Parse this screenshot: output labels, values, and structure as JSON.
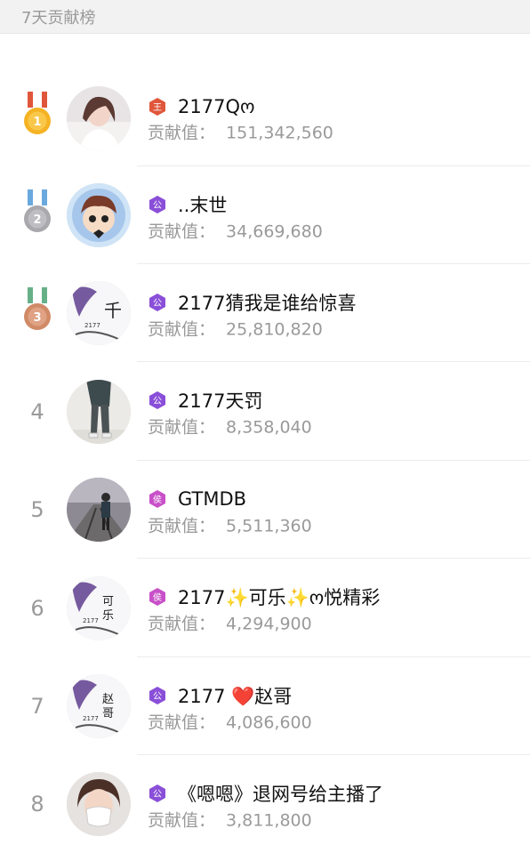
{
  "header": {
    "title": "7天贡献榜"
  },
  "contrib_label": "贡献值：",
  "rows": [
    {
      "rank": "1",
      "medal": "gold-medal-icon",
      "badge": {
        "char": "王",
        "color": "#e0563b"
      },
      "name": "2177Qო",
      "value": "151,342,560",
      "avatar": "avatar-woman-photo"
    },
    {
      "rank": "2",
      "medal": "silver-medal-icon",
      "badge": {
        "char": "公",
        "color": "#8a4fd8"
      },
      "name": "..末世",
      "value": "34,669,680",
      "avatar": "avatar-cartoon"
    },
    {
      "rank": "3",
      "medal": "bronze-medal-icon",
      "badge": {
        "char": "公",
        "color": "#8a4fd8"
      },
      "name": "2177猜我是谁给惊喜",
      "value": "25,810,820",
      "avatar": "avatar-ink-calligraphy"
    },
    {
      "rank": "4",
      "badge": {
        "char": "公",
        "color": "#8a4fd8"
      },
      "name": "2177天罚",
      "value": "8,358,040",
      "avatar": "avatar-person-legs"
    },
    {
      "rank": "5",
      "badge": {
        "char": "侯",
        "color": "#c850c8"
      },
      "name": "GTMDB",
      "value": "5,511,360",
      "avatar": "avatar-person-railway"
    },
    {
      "rank": "6",
      "badge": {
        "char": "侯",
        "color": "#c850c8"
      },
      "name": "2177✨可乐✨ო悦精彩",
      "value": "4,294,900",
      "avatar": "avatar-ink-calligraphy"
    },
    {
      "rank": "7",
      "badge": {
        "char": "公",
        "color": "#8a4fd8"
      },
      "name": "2177 ❤️赵哥",
      "value": "4,086,600",
      "avatar": "avatar-ink-calligraphy"
    },
    {
      "rank": "8",
      "badge": {
        "char": "公",
        "color": "#8a4fd8"
      },
      "name": "《嗯嗯》退网号给主播了",
      "value": "3,811,800",
      "avatar": "avatar-woman-mask"
    }
  ]
}
